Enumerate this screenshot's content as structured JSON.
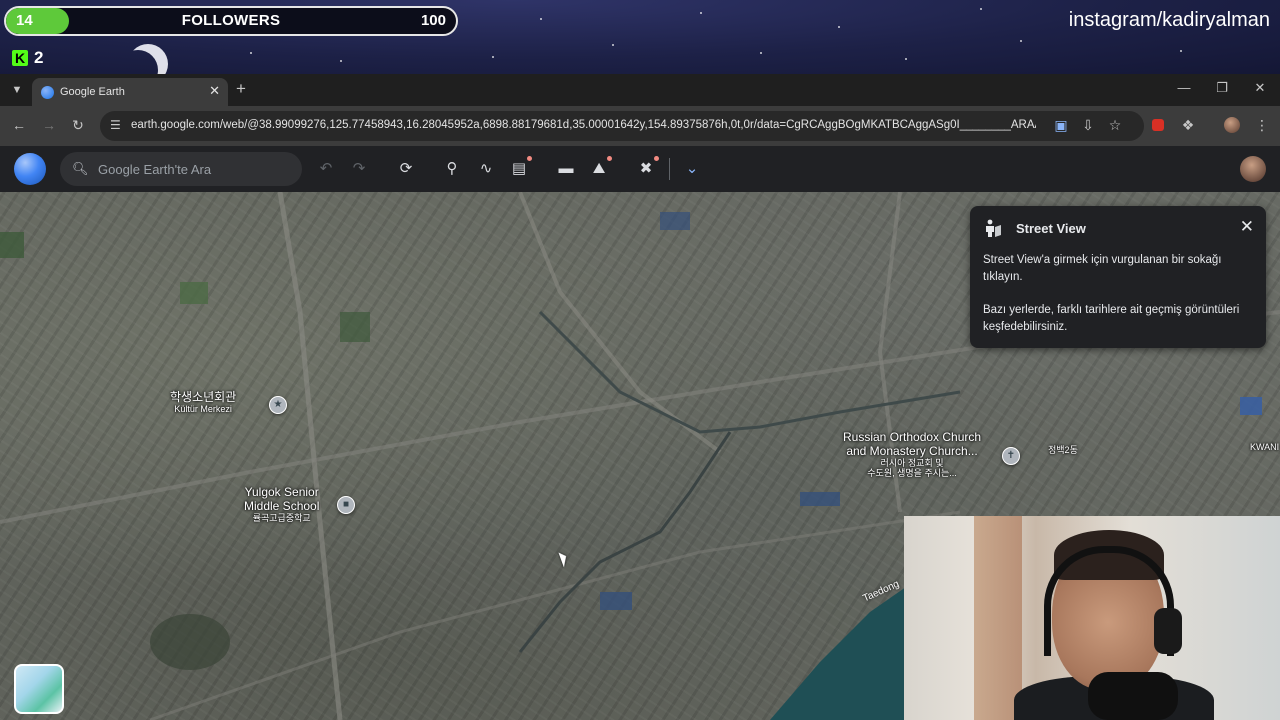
{
  "overlay": {
    "followers_current": "14",
    "followers_label": "FOLLOWERS",
    "followers_goal": "100",
    "followers_progress": 0.14,
    "kick_count": "2",
    "instagram": "instagram/kadiryalman"
  },
  "browser": {
    "tab_title": "Google Earth",
    "url": "earth.google.com/web/@38.99099276,125.77458943,16.28045952a,6898.88179681d,35.00001642y,154.89375876h,0t,0r/data=CgRCAggBOgMKATBCAggASg0I________ARAA"
  },
  "google_earth": {
    "search_placeholder": "Google Earth'te Ara"
  },
  "street_view_panel": {
    "title": "Street View",
    "paragraph1": "Street View'a girmek için vurgulanan bir sokağı tıklayın.",
    "paragraph2": "Bazı yerlerde, farklı tarihlere ait geçmiş görüntüleri keşfedebilirsiniz."
  },
  "map_labels": {
    "poi1_name": "학생소년회관",
    "poi1_sub": "Kültür Merkezi",
    "poi2_name_line1": "Yulgok Senior",
    "poi2_name_line2": "Middle School",
    "poi2_sub": "률곡고급중학교",
    "poi3_name_line1": "Russian Orthodox Church",
    "poi3_name_line2": "and Monastery Church...",
    "poi3_sub_line1": "러시아 정교회 및",
    "poi3_sub_line2": "수도원, 생명을 주시는...",
    "poi4_name": "정백2동",
    "poi5_name": "KWANI",
    "river": "Taedong"
  },
  "colors": {
    "followers_fill": "#5ec93a",
    "browser_dark": "#1f1f1f",
    "ge_toolbar": "#202124"
  }
}
